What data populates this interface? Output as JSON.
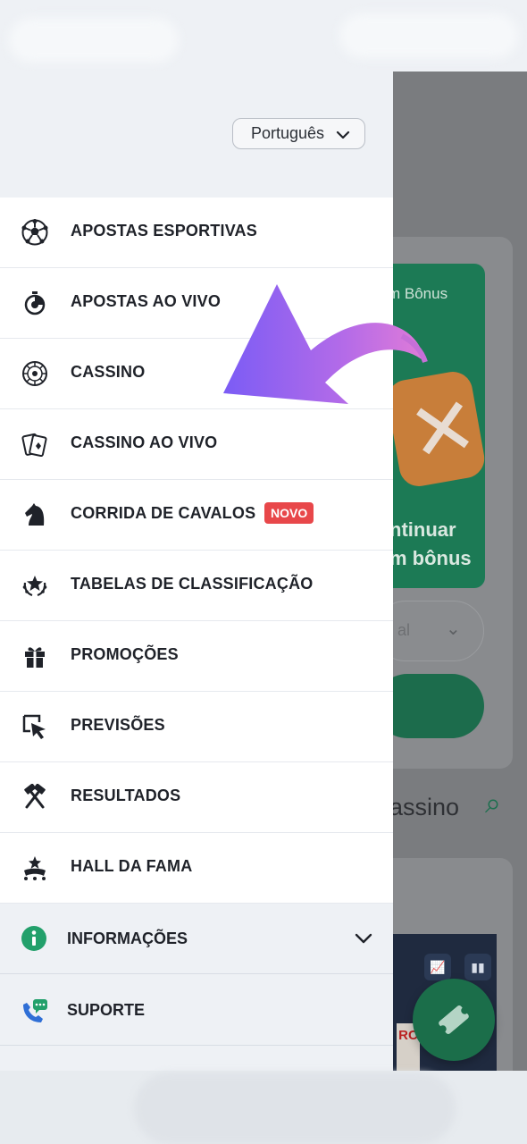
{
  "language": {
    "selected": "Português"
  },
  "menu": {
    "items": [
      {
        "label": "APOSTAS ESPORTIVAS",
        "icon": "soccer-ball-icon"
      },
      {
        "label": "APOSTAS AO VIVO",
        "icon": "stopwatch-icon"
      },
      {
        "label": "CASSINO",
        "icon": "roulette-icon"
      },
      {
        "label": "CASSINO AO VIVO",
        "icon": "playing-cards-icon"
      },
      {
        "label": "CORRIDA DE CAVALOS",
        "icon": "horse-knight-icon",
        "badge": "NOVO"
      },
      {
        "label": "TABELAS DE CLASSIFICAÇÃO",
        "icon": "laurel-star-icon"
      },
      {
        "label": "PROMOÇÕES",
        "icon": "gift-icon"
      },
      {
        "label": "PREVISÕES",
        "icon": "cursor-select-icon"
      },
      {
        "label": "RESULTADOS",
        "icon": "crossed-hammers-icon"
      },
      {
        "label": "HALL DA FAMA",
        "icon": "trophy-stars-icon"
      }
    ],
    "info_label": "INFORMAÇÕES",
    "support_label": "SUPORTE"
  },
  "background": {
    "bonus_title": "m Bônus",
    "bonus_cta_line1": "ntinuar",
    "bonus_cta_line2": "m bônus",
    "select_value": "al",
    "section_title": "assino",
    "logo_text": "RC"
  },
  "colors": {
    "accent_green": "#1c7a55",
    "badge_red": "#e8474a",
    "info_green": "#22a06b",
    "support_blue": "#2f6fd6",
    "arrow_purple": "#9b5cf0",
    "arrow_pink": "#e07bd8"
  }
}
